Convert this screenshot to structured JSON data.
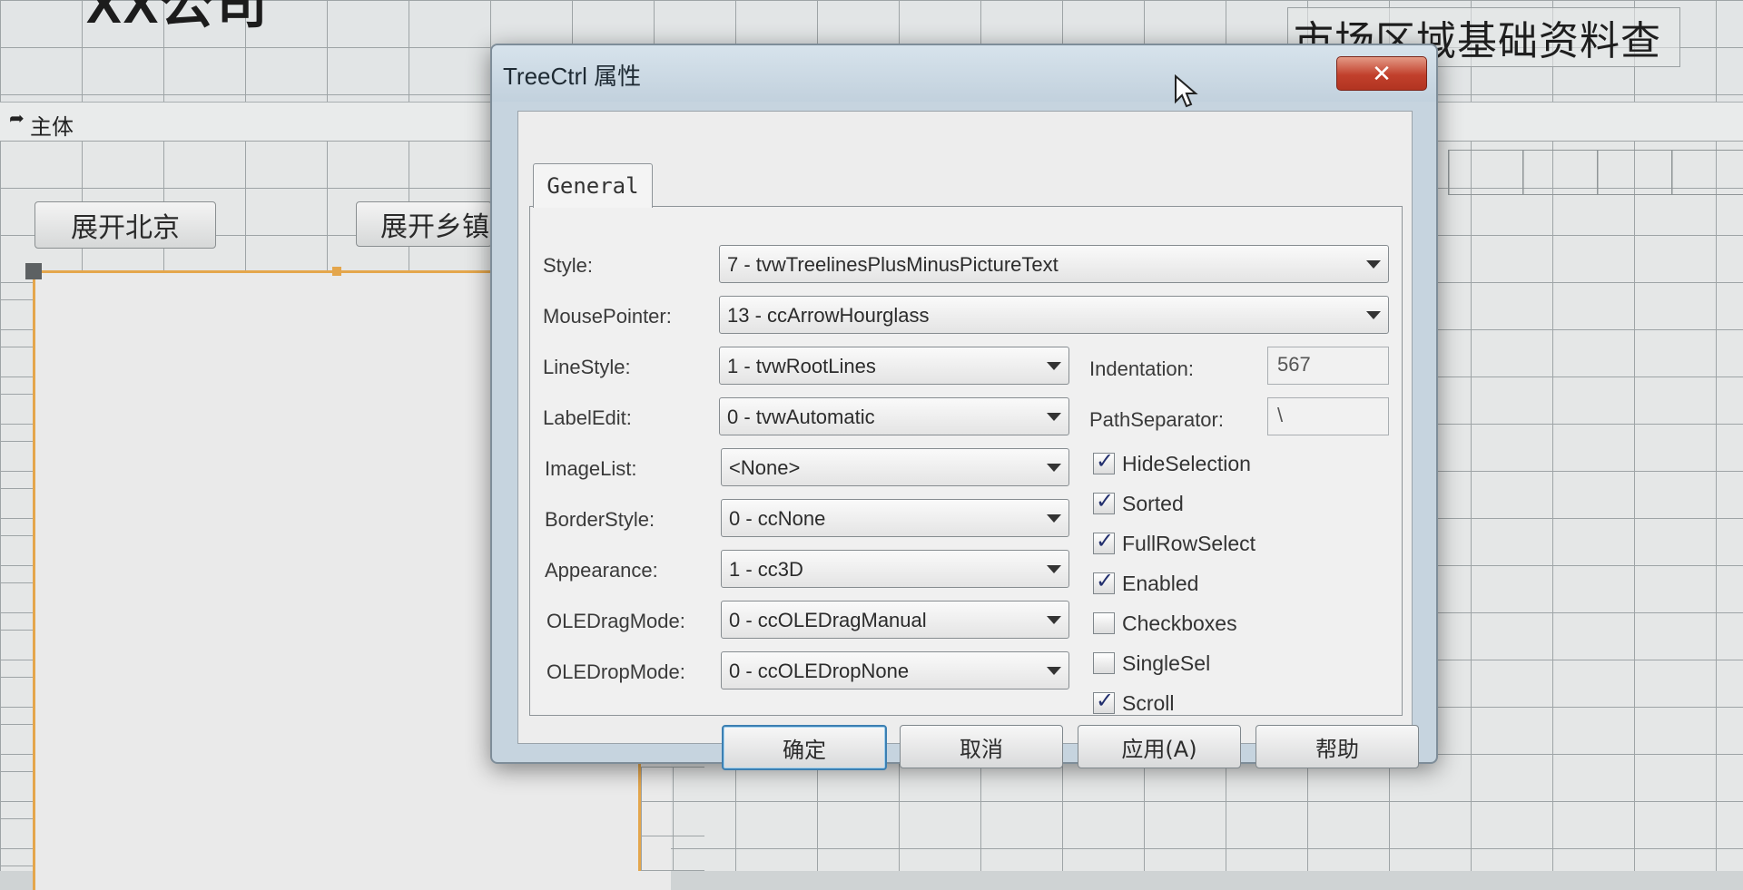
{
  "background": {
    "company_title": "XX公司",
    "report_title": "市场区域基础资料查",
    "section_label": "主体",
    "buttons": [
      "展开北京",
      "展开乡镇"
    ]
  },
  "dialog": {
    "title": "TreeCtrl 属性",
    "close_label": "✕",
    "tab_label": "General",
    "properties": {
      "style_label": "Style:",
      "style_value": "7 - tvwTreelinesPlusMinusPictureText",
      "mousepointer_label": "MousePointer:",
      "mousepointer_value": "13 - ccArrowHourglass",
      "linestyle_label": "LineStyle:",
      "linestyle_value": "1 - tvwRootLines",
      "labeledit_label": "LabelEdit:",
      "labeledit_value": "0 - tvwAutomatic",
      "imagelist_label": "ImageList:",
      "imagelist_value": "<None>",
      "borderstyle_label": "BorderStyle:",
      "borderstyle_value": "0 - ccNone",
      "appearance_label": "Appearance:",
      "appearance_value": "1 - cc3D",
      "oledragmode_label": "OLEDragMode:",
      "oledragmode_value": "0 - ccOLEDragManual",
      "oledropmode_label": "OLEDropMode:",
      "oledropmode_value": "0 - ccOLEDropNone",
      "indentation_label": "Indentation:",
      "indentation_value": "567",
      "pathseparator_label": "PathSeparator:",
      "pathseparator_value": "\\"
    },
    "checkboxes": [
      {
        "label": "HideSelection",
        "checked": true
      },
      {
        "label": "Sorted",
        "checked": true
      },
      {
        "label": "FullRowSelect",
        "checked": true
      },
      {
        "label": "Enabled",
        "checked": true
      },
      {
        "label": "Checkboxes",
        "checked": false
      },
      {
        "label": "SingleSel",
        "checked": false
      },
      {
        "label": "Scroll",
        "checked": true
      }
    ],
    "buttons": {
      "ok": "确定",
      "cancel": "取消",
      "apply": "应用(A)",
      "help": "帮助"
    }
  }
}
